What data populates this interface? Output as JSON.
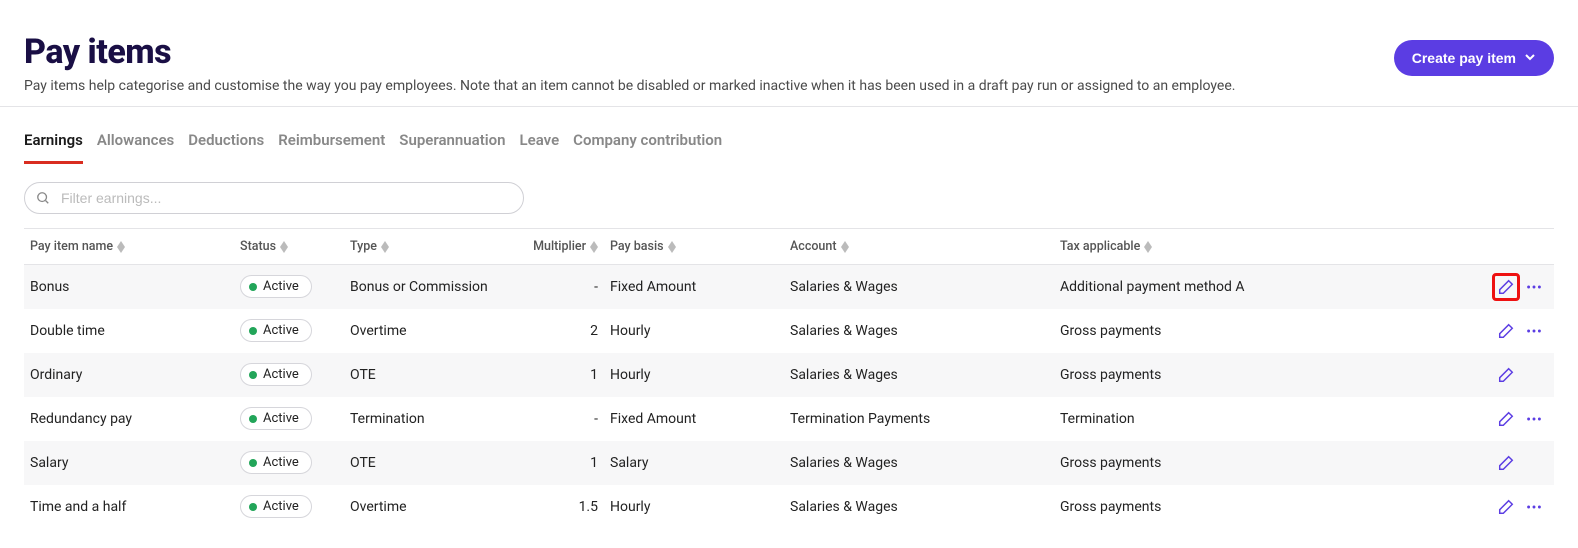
{
  "header": {
    "title": "Pay items",
    "description": "Pay items help categorise and customise the way you pay employees. Note that an item cannot be disabled or marked inactive when it has been used in a draft pay run or assigned to an employee.",
    "create_label": "Create pay item"
  },
  "tabs": [
    {
      "label": "Earnings",
      "active": true
    },
    {
      "label": "Allowances",
      "active": false
    },
    {
      "label": "Deductions",
      "active": false
    },
    {
      "label": "Reimbursement",
      "active": false
    },
    {
      "label": "Superannuation",
      "active": false
    },
    {
      "label": "Leave",
      "active": false
    },
    {
      "label": "Company contribution",
      "active": false
    }
  ],
  "filter": {
    "placeholder": "Filter earnings..."
  },
  "columns": {
    "name": "Pay item name",
    "status": "Status",
    "type": "Type",
    "multiplier": "Multiplier",
    "basis": "Pay basis",
    "account": "Account",
    "tax": "Tax applicable"
  },
  "rows": [
    {
      "name": "Bonus",
      "status": "Active",
      "type": "Bonus or Commission",
      "multiplier": "-",
      "basis": "Fixed Amount",
      "account": "Salaries & Wages",
      "tax": "Additional payment method A",
      "highlight_edit": true,
      "more": true
    },
    {
      "name": "Double time",
      "status": "Active",
      "type": "Overtime",
      "multiplier": "2",
      "basis": "Hourly",
      "account": "Salaries & Wages",
      "tax": "Gross payments",
      "highlight_edit": false,
      "more": true
    },
    {
      "name": "Ordinary",
      "status": "Active",
      "type": "OTE",
      "multiplier": "1",
      "basis": "Hourly",
      "account": "Salaries & Wages",
      "tax": "Gross payments",
      "highlight_edit": false,
      "more": false
    },
    {
      "name": "Redundancy pay",
      "status": "Active",
      "type": "Termination",
      "multiplier": "-",
      "basis": "Fixed Amount",
      "account": "Termination Payments",
      "tax": "Termination",
      "highlight_edit": false,
      "more": true
    },
    {
      "name": "Salary",
      "status": "Active",
      "type": "OTE",
      "multiplier": "1",
      "basis": "Salary",
      "account": "Salaries & Wages",
      "tax": "Gross payments",
      "highlight_edit": false,
      "more": false
    },
    {
      "name": "Time and a half",
      "status": "Active",
      "type": "Overtime",
      "multiplier": "1.5",
      "basis": "Hourly",
      "account": "Salaries & Wages",
      "tax": "Gross payments",
      "highlight_edit": false,
      "more": true
    }
  ]
}
